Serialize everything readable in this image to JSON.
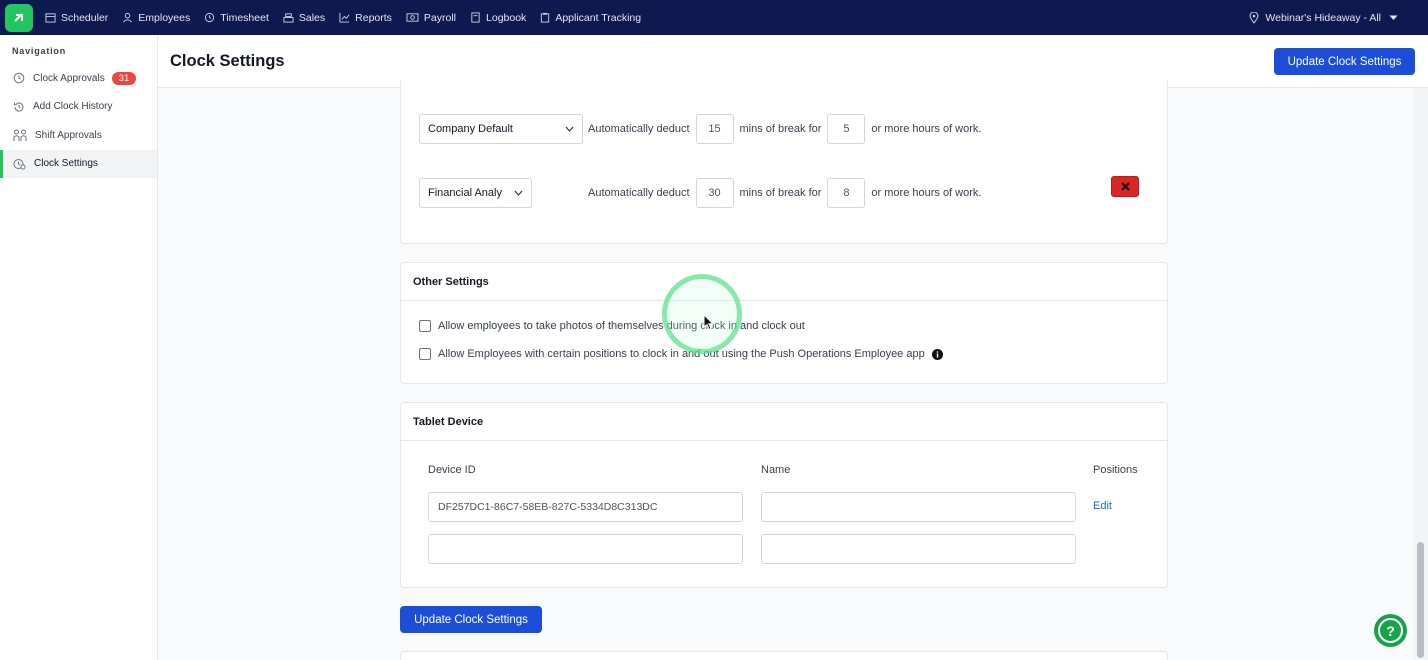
{
  "topnav": {
    "items": [
      {
        "label": "Scheduler",
        "icon": "calendar-icon"
      },
      {
        "label": "Employees",
        "icon": "person-icon"
      },
      {
        "label": "Timesheet",
        "icon": "clock-icon"
      },
      {
        "label": "Sales",
        "icon": "register-icon"
      },
      {
        "label": "Reports",
        "icon": "chart-icon"
      },
      {
        "label": "Payroll",
        "icon": "money-icon"
      },
      {
        "label": "Logbook",
        "icon": "book-icon"
      },
      {
        "label": "Applicant Tracking",
        "icon": "clipboard-icon"
      }
    ],
    "location": "Webinar's Hideaway - All"
  },
  "sidebar": {
    "title": "Navigation",
    "items": [
      {
        "label": "Clock Approvals",
        "badge": "31",
        "icon": "clock-icon"
      },
      {
        "label": "Add Clock History",
        "icon": "history-icon"
      },
      {
        "label": "Shift Approvals",
        "icon": "shift-icon"
      },
      {
        "label": "Clock Settings",
        "icon": "clock-settings-icon",
        "active": true
      }
    ]
  },
  "header": {
    "title": "Clock Settings",
    "update_button": "Update Clock Settings"
  },
  "break_rules": {
    "rules": [
      {
        "position": "Company Default",
        "deduct_label": "Automatically deduct",
        "minutes": "15",
        "mins_label": "mins of break for",
        "hours": "5",
        "hours_label": "or more hours of work."
      },
      {
        "position": "Financial Analy",
        "deduct_label": "Automatically deduct",
        "minutes": "30",
        "mins_label": "mins of break for",
        "hours": "8",
        "hours_label": "or more hours of work."
      }
    ]
  },
  "other_settings": {
    "title": "Other Settings",
    "options": [
      {
        "label": "Allow employees to take photos of themselves during clock in and clock out",
        "checked": false
      },
      {
        "label": "Allow Employees with certain positions to clock in and out using the Push Operations Employee app",
        "checked": false
      }
    ]
  },
  "tablet_device": {
    "title": "Tablet Device",
    "columns": {
      "device_id": "Device ID",
      "name": "Name",
      "positions": "Positions"
    },
    "rows": [
      {
        "device_id": "DF257DC1-86C7-58EB-827C-5334D8C313DC",
        "name": "",
        "positions_link": "Edit"
      },
      {
        "device_id": "",
        "name": ""
      }
    ]
  },
  "footer": {
    "update_button": "Update Clock Settings"
  },
  "colors": {
    "nav_bg": "#0e1a4f",
    "primary": "#1d4ed8",
    "accent": "#22c55e",
    "danger": "#dc2626",
    "badge": "#ef4444"
  }
}
